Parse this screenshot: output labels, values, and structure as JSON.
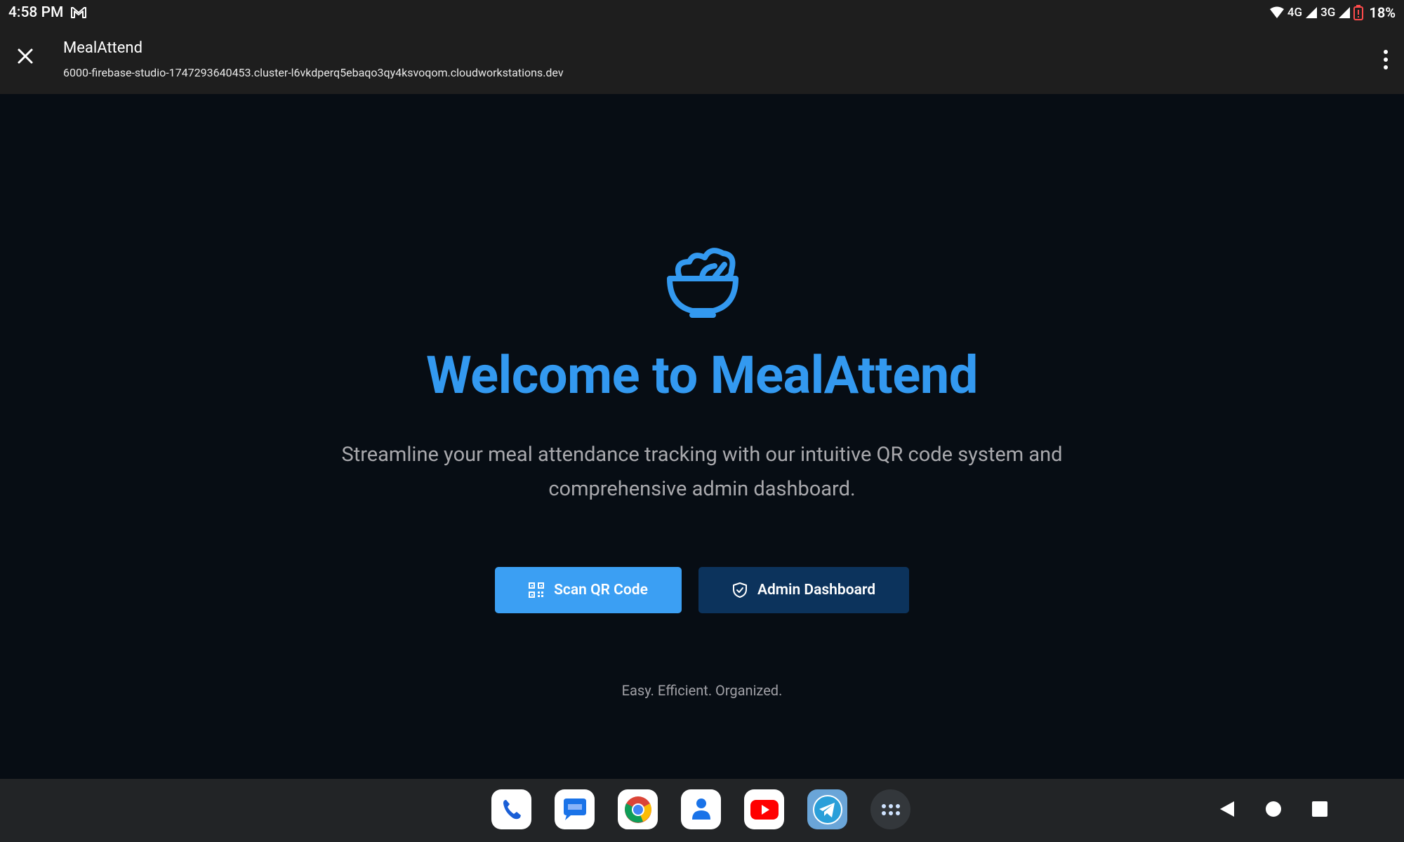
{
  "status_bar": {
    "time": "4:58 PM",
    "network_1": "4G",
    "network_2": "3G",
    "battery": "18%"
  },
  "header": {
    "title": "MealAttend",
    "url": "6000-firebase-studio-1747293640453.cluster-l6vkdperq5ebaqo3qy4ksvoqom.cloudworkstations.dev"
  },
  "main": {
    "heading": "Welcome to MealAttend",
    "subtitle": "Streamline your meal attendance tracking with our intuitive QR code system and comprehensive admin dashboard.",
    "scan_button": "Scan QR Code",
    "admin_button": "Admin Dashboard",
    "tagline": "Easy. Efficient. Organized."
  },
  "dock": {
    "apps": [
      "phone-icon",
      "messages-icon",
      "chrome-icon",
      "contacts-icon",
      "youtube-icon",
      "telegram-icon",
      "app-drawer-icon"
    ]
  },
  "colors": {
    "accent": "#3399f0",
    "scan_button": "#3b9ff3",
    "admin_button": "#0c335c",
    "background": "#070d14"
  }
}
